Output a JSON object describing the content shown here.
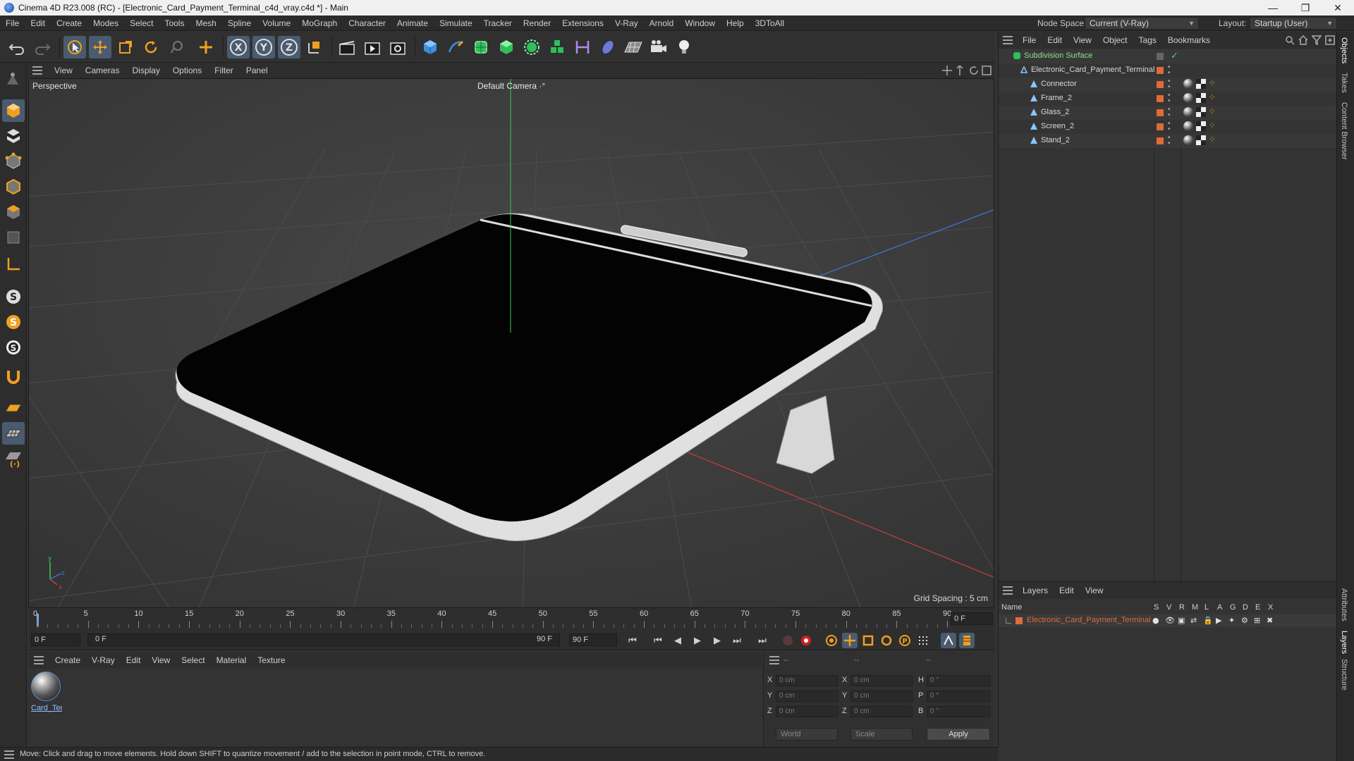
{
  "window": {
    "title": "Cinema 4D R23.008 (RC) - [Electronic_Card_Payment_Terminal_c4d_vray.c4d *] - Main",
    "minimize": "—",
    "maximize": "❐",
    "close": "✕"
  },
  "menubar": {
    "items": [
      "File",
      "Edit",
      "Create",
      "Modes",
      "Select",
      "Tools",
      "Mesh",
      "Spline",
      "Volume",
      "MoGraph",
      "Character",
      "Animate",
      "Simulate",
      "Tracker",
      "Render",
      "Extensions",
      "V-Ray",
      "Arnold",
      "Window",
      "Help",
      "3DToAll"
    ],
    "node_space_label": "Node Space:",
    "node_space_value": "Current (V-Ray)",
    "layout_label": "Layout:",
    "layout_value": "Startup (User)"
  },
  "viewport": {
    "menu": [
      "View",
      "Cameras",
      "Display",
      "Options",
      "Filter",
      "Panel"
    ],
    "label": "Perspective",
    "camera": "Default Camera",
    "grid_spacing": "Grid Spacing : 5 cm"
  },
  "timeline": {
    "ticks": [
      "0",
      "5",
      "10",
      "15",
      "20",
      "25",
      "30",
      "35",
      "40",
      "45",
      "50",
      "55",
      "60",
      "65",
      "70",
      "75",
      "80",
      "85",
      "90"
    ],
    "current_frame_field": "0 F",
    "start_field": "0 F",
    "range_start": "0 F",
    "range_end": "90 F",
    "end_field": "90 F"
  },
  "material_manager": {
    "menu": [
      "Create",
      "V-Ray",
      "Edit",
      "View",
      "Select",
      "Material",
      "Texture"
    ],
    "materials": [
      {
        "name": "Card_Ter"
      }
    ]
  },
  "coordinates": {
    "headers": [
      "--",
      "--",
      "--"
    ],
    "pos": {
      "x": "0 cm",
      "y": "0 cm",
      "z": "0 cm"
    },
    "size": {
      "x": "0 cm",
      "y": "0 cm",
      "z": "0 cm"
    },
    "rot": {
      "h": "0 °",
      "p": "0 °",
      "b": "0 °"
    },
    "axis_labels": {
      "x": "X",
      "y": "Y",
      "z": "Z",
      "h": "H",
      "p": "P",
      "b": "B"
    },
    "mode_dropdown": "World",
    "scale_dropdown": "Scale",
    "apply_label": "Apply"
  },
  "status": {
    "text": "Move: Click and drag to move elements. Hold down SHIFT to quantize movement / add to the selection in point mode, CTRL to remove."
  },
  "object_manager": {
    "menu": [
      "File",
      "Edit",
      "View",
      "Object",
      "Tags",
      "Bookmarks"
    ],
    "objects": [
      {
        "name": "Subdivision Surface",
        "color": "#8fe08f"
      },
      {
        "name": "Electronic_Card_Payment_Terminal",
        "color": "#d8d8d8"
      },
      {
        "name": "Connector",
        "color": "#d8d8d8"
      },
      {
        "name": "Frame_2",
        "color": "#d8d8d8"
      },
      {
        "name": "Glass_2",
        "color": "#d8d8d8"
      },
      {
        "name": "Screen_2",
        "color": "#d8d8d8"
      },
      {
        "name": "Stand_2",
        "color": "#d8d8d8"
      }
    ]
  },
  "layers": {
    "menu": [
      "Layers",
      "Edit",
      "View"
    ],
    "name_header": "Name",
    "column_headers": [
      "S",
      "V",
      "R",
      "M",
      "L",
      "A",
      "G",
      "D",
      "E",
      "X"
    ],
    "rows": [
      {
        "name": "Electronic_Card_Payment_Terminal",
        "color": "#e06a3a"
      }
    ]
  },
  "side_tabs": [
    "Objects",
    "Takes",
    "Content Browser",
    "Attributes",
    "Layers",
    "Structure"
  ],
  "colors": {
    "accent": "#4a5b70",
    "layer_orange": "#e06a3a",
    "axis_x": "#c83c3c",
    "axis_y": "#3cc850",
    "axis_z": "#3c78d8"
  }
}
